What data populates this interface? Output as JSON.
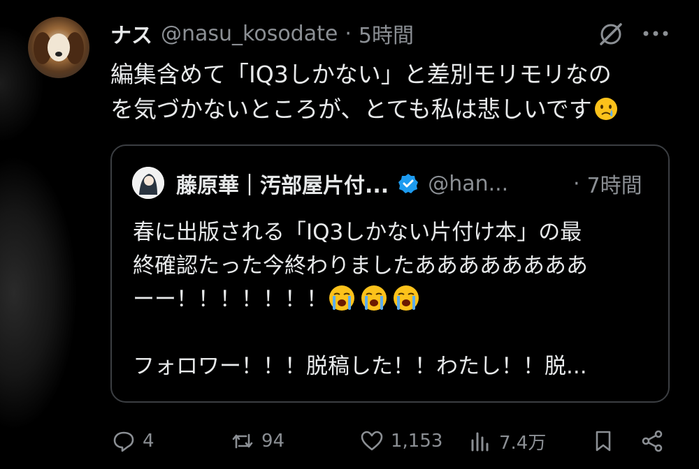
{
  "tweet": {
    "name": "ナス",
    "handle": "@nasu_kosodate",
    "separator": "·",
    "time": "5時間",
    "text_line1": "編集含めて「IQ3しかない」と差別モリモリなの",
    "text_line2": "を気づかないところが、とても私は悲しいです",
    "emoji": "crying-face"
  },
  "quote": {
    "name": "藤原華｜汚部屋片付...",
    "verified": true,
    "handle": "@han...",
    "separator": "·",
    "time": "7時間",
    "line1": "春に出版される「IQ3しかない片付け本」の最",
    "line2": "終確認たった今終わりましたああああああああ",
    "line3": "ーー！！！！！！！",
    "line3_emoji": [
      "loudly-crying-face",
      "loudly-crying-face",
      "loudly-crying-face"
    ],
    "line4": "フォロワー！！！脱稿した！！わたし！！脱..."
  },
  "actions": {
    "replies": "4",
    "retweets": "94",
    "likes": "1,153",
    "views": "7.4万"
  },
  "colors": {
    "background": "#000000",
    "text": "#e7e9ea",
    "muted": "#8b8f94",
    "border": "#3b3e42",
    "verified": "#1d9bf0"
  }
}
